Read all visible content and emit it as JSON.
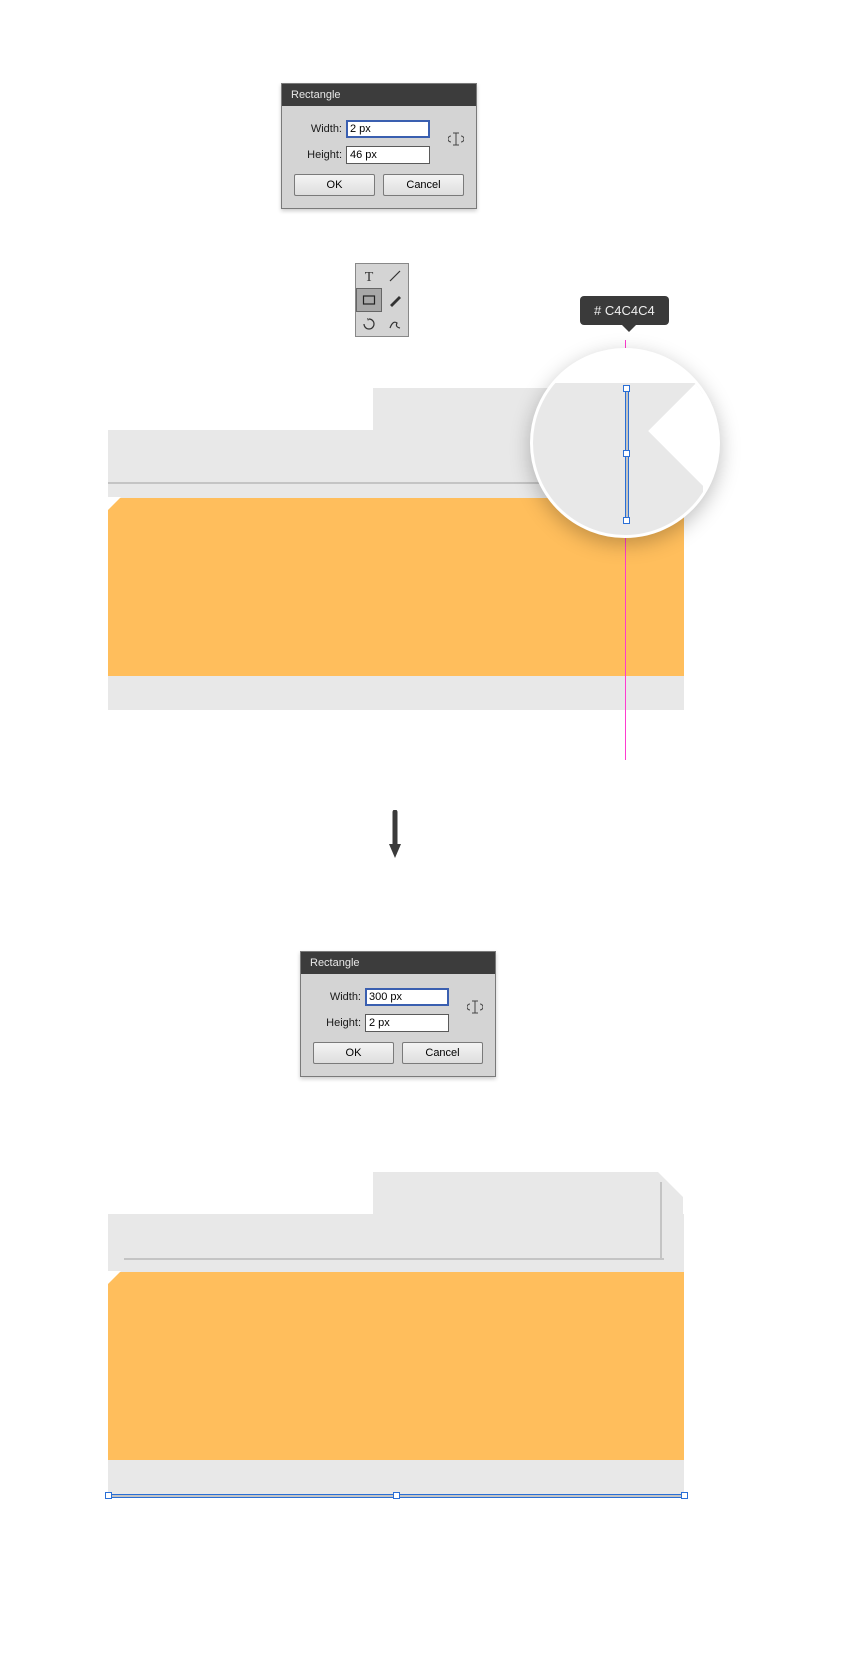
{
  "dialog1": {
    "title": "Rectangle",
    "width_label": "Width:",
    "height_label": "Height:",
    "width_value": "2 px",
    "height_value": "46 px",
    "ok": "OK",
    "cancel": "Cancel"
  },
  "dialog2": {
    "title": "Rectangle",
    "width_label": "Width:",
    "height_label": "Height:",
    "width_value": "300 px",
    "height_value": "2 px",
    "ok": "OK",
    "cancel": "Cancel"
  },
  "color_hint": "# C4C4C4",
  "tools": {
    "type": "type-tool",
    "line": "line-tool",
    "rect": "rectangle-tool",
    "brush": "brush-tool",
    "rotate": "rotate-tool",
    "freeform": "freeform-tool"
  },
  "colors": {
    "folder_back": "#e8e8e8",
    "folder_front": "#ffbe5c",
    "detail_line": "#c4c4c4",
    "guide": "#ff3bd0"
  }
}
